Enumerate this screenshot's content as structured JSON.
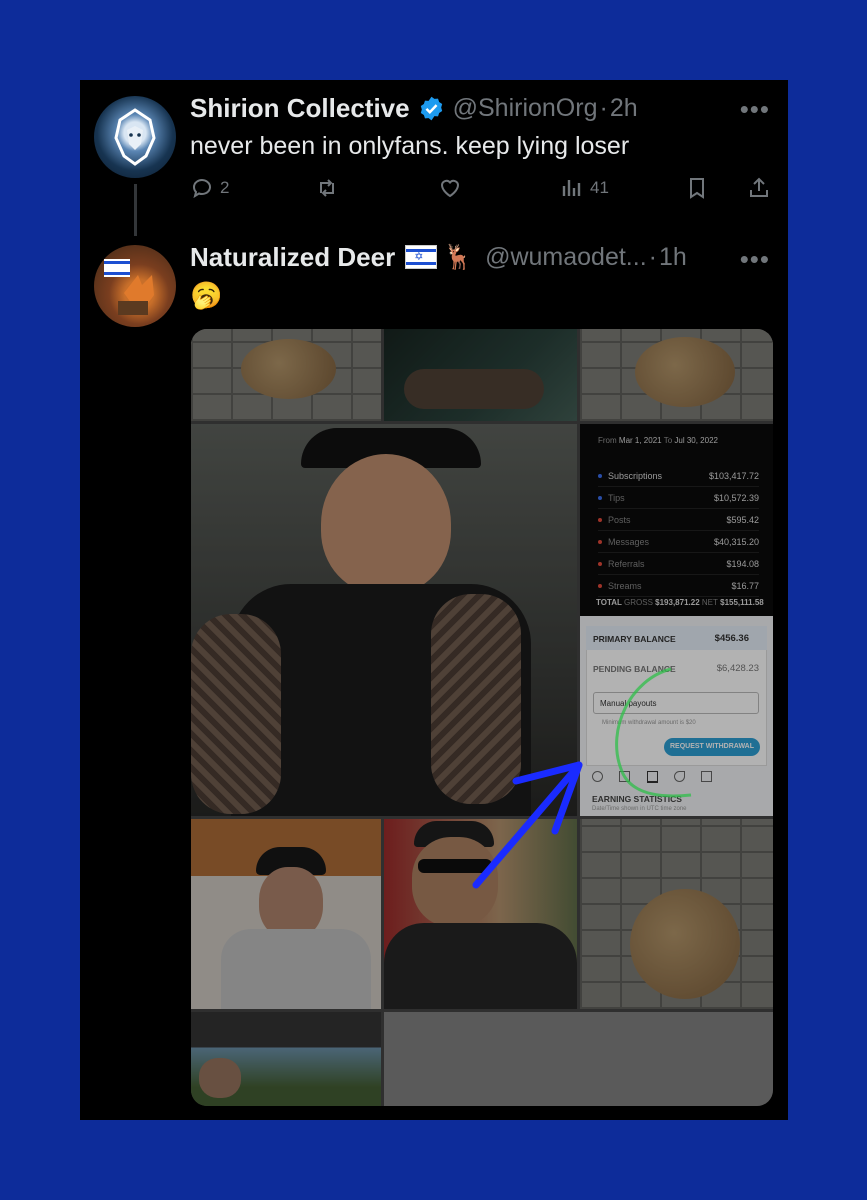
{
  "tweets": [
    {
      "name": "Shirion Collective",
      "handle": "@ShirionOrg",
      "separator": "·",
      "time": "2h",
      "text": "never been in onlyfans. keep lying loser",
      "actions": {
        "reply_count": "2",
        "views_count": "41"
      }
    },
    {
      "name": "Naturalized Deer",
      "handle": "@wumaodet...",
      "separator": "·",
      "time": "1h",
      "text": "🥱"
    }
  ],
  "icons": {
    "more": "more-dots-icon",
    "verified": "verified-badge-icon",
    "reply": "reply-icon",
    "repost": "repost-icon",
    "like": "like-icon",
    "views": "views-icon",
    "bookmark": "bookmark-icon",
    "share": "share-icon"
  },
  "more_label": "•••",
  "screenshot": {
    "date_from_label": "From",
    "date_from": "Mar 1, 2021",
    "date_to_label": "To",
    "date_to": "Jul 30, 2022",
    "rows": [
      {
        "label": "Subscriptions",
        "value": "$103,417.72",
        "color": "#3b6ff0"
      },
      {
        "label": "Tips",
        "value": "$10,572.39",
        "color": "#3b6ff0"
      },
      {
        "label": "Posts",
        "value": "$595.42",
        "color": "#e24a3b"
      },
      {
        "label": "Messages",
        "value": "$40,315.20",
        "color": "#e24a3b"
      },
      {
        "label": "Referrals",
        "value": "$194.08",
        "color": "#e24a3b"
      },
      {
        "label": "Streams",
        "value": "$16.77",
        "color": "#e24a3b"
      }
    ],
    "total_label": "TOTAL",
    "gross_label": "GROSS",
    "gross": "$193,871.22",
    "net_label": "NET",
    "net": "$155,111.58",
    "primary_balance_label": "PRIMARY BALANCE",
    "primary_balance": "$456.36",
    "pending_balance_label": "PENDING BALANCE",
    "pending_balance": "$6,428.23",
    "payout_option": "Manual payouts",
    "min_withdrawal": "Minimum withdrawal amount is $20",
    "request_button": "REQUEST WITHDRAWAL",
    "earning_statistics": "EARNING STATISTICS",
    "timezone_note": "Date/Time shown in UTC time zone"
  },
  "colors": {
    "background": "#0d2c9a",
    "card": "#000000",
    "verified": "#1d9bf0",
    "annotation_arrow": "#1a2bff",
    "annotation_curve": "#2fbf4a"
  }
}
